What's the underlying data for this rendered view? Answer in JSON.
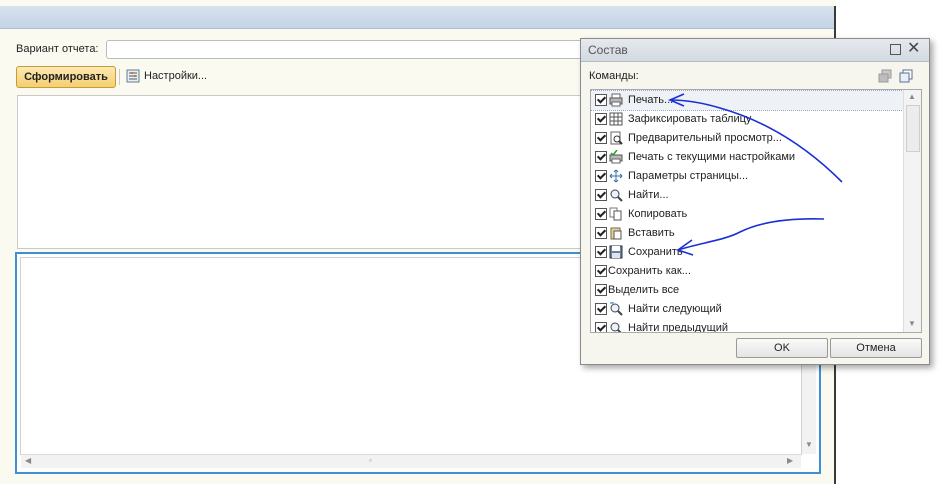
{
  "form": {
    "variant_label": "Вариант отчета:",
    "variant_value": "",
    "generate_button": "Сформировать",
    "settings_button": "Настройки..."
  },
  "dialog": {
    "title": "Состав",
    "commands_label": "Команды:",
    "items": [
      {
        "label": "Печать...",
        "checked": true,
        "icon": "printer-icon"
      },
      {
        "label": "Зафиксировать таблицу",
        "checked": true,
        "icon": "table-grid-icon"
      },
      {
        "label": "Предварительный просмотр...",
        "checked": true,
        "icon": "print-preview-icon"
      },
      {
        "label": "Печать с текущими настройками",
        "checked": true,
        "icon": "printer-check-icon"
      },
      {
        "label": "Параметры страницы...",
        "checked": true,
        "icon": "page-setup-icon"
      },
      {
        "label": "Найти...",
        "checked": true,
        "icon": "magnifier-icon"
      },
      {
        "label": "Копировать",
        "checked": true,
        "icon": "copy-icon"
      },
      {
        "label": "Вставить",
        "checked": true,
        "icon": "paste-icon"
      },
      {
        "label": "Сохранить",
        "checked": true,
        "icon": "floppy-disk-icon"
      },
      {
        "label": "Сохранить как...",
        "checked": true,
        "icon": ""
      },
      {
        "label": "Выделить все",
        "checked": true,
        "icon": ""
      },
      {
        "label": "Найти следующий",
        "checked": true,
        "icon": "find-next-icon"
      },
      {
        "label": "Найти предыдущий",
        "checked": true,
        "icon": "find-previous-icon"
      }
    ],
    "ok_button": "OK",
    "cancel_button": "Отмена"
  },
  "colors": {
    "generate_button": "#f4cf6f",
    "selection_border": "#3f8fd6",
    "annotation_ink": "#1a2fd6"
  }
}
